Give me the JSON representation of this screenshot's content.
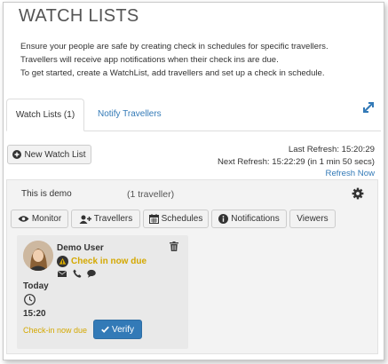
{
  "page": {
    "title": "WATCH LISTS",
    "description": [
      "Ensure your people are safe by creating check in schedules for specific travellers.",
      "Travellers will receive app notifications when their check ins are due.",
      "To get started, create a WatchList, add travellers and set up a check in schedule."
    ]
  },
  "tabs": [
    {
      "label": "Watch Lists (1)",
      "active": true
    },
    {
      "label": "Notify Travellers",
      "active": false
    }
  ],
  "toolbar": {
    "new_watch_list_label": "New Watch List",
    "last_refresh": "Last Refresh: 15:20:29",
    "next_refresh": "Next Refresh: 15:22:29 (in 1 min 50 secs)",
    "refresh_now_label": "Refresh Now"
  },
  "watchlist": {
    "name": "This is demo",
    "count": "(1 traveller)",
    "actions": [
      "Monitor",
      "Travellers",
      "Schedules",
      "Notifications",
      "Viewers"
    ]
  },
  "traveller": {
    "name": "Demo User",
    "status": "Check in now due",
    "day": "Today",
    "time": "15:20",
    "footer_status": "Check-in now due",
    "verify_label": "Verify"
  },
  "colors": {
    "accent": "#337ab7",
    "warning": "#d4a800",
    "panel": "#f3f3f3",
    "card": "#e9e9e9"
  }
}
